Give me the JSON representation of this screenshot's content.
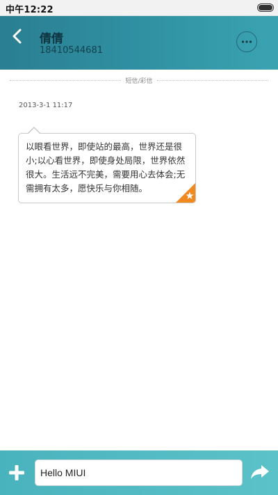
{
  "status_bar": {
    "time": "中午12:22",
    "battery_level": 1.0
  },
  "header": {
    "contact_name": "倩倩",
    "contact_number": "18410544681",
    "back_icon": "back-chevron-icon",
    "more_icon": "more-options-icon"
  },
  "thread": {
    "type_label": "短信/彩信",
    "messages": [
      {
        "timestamp": "2013-3-1 11:17",
        "text": "以眼看世界，即使站的最高，世界还是很小;以心看世界，即使身处局限，世界依然很大。生活远不完美，需要用心去体会;无需拥有太多，愿快乐与你相随。",
        "starred": true
      }
    ]
  },
  "composer": {
    "input_value": "Hello MIUI",
    "add_icon": "plus-icon",
    "send_icon": "send-arrow-icon"
  },
  "colors": {
    "header_bg": "#2f8ea1",
    "bottom_bar_bg": "#52bac3",
    "star_badge": "#f08a1e"
  }
}
